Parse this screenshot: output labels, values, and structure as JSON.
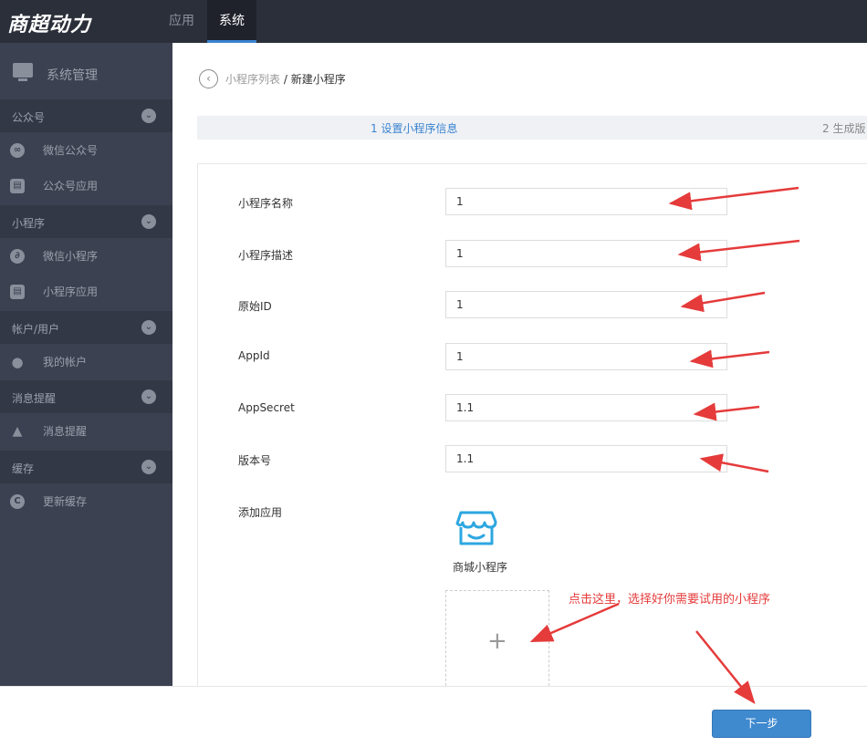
{
  "topbar": {
    "logo": "商超动力",
    "tabs": [
      {
        "label": "应用"
      },
      {
        "label": "系统"
      }
    ]
  },
  "sidebar": {
    "header": "系统管理",
    "groups": [
      {
        "label": "公众号",
        "items": [
          {
            "label": "微信公众号",
            "icon": "wechat-icon"
          },
          {
            "label": "公众号应用",
            "icon": "app-bag-icon"
          }
        ]
      },
      {
        "label": "小程序",
        "items": [
          {
            "label": "微信小程序",
            "icon": "mini-program-icon"
          },
          {
            "label": "小程序应用",
            "icon": "app-bag-icon"
          }
        ]
      },
      {
        "label": "帐户/用户",
        "items": [
          {
            "label": "我的帐户",
            "icon": "user-icon"
          }
        ]
      },
      {
        "label": "消息提醒",
        "items": [
          {
            "label": "消息提醒",
            "icon": "bell-icon"
          }
        ]
      },
      {
        "label": "缓存",
        "items": [
          {
            "label": "更新缓存",
            "icon": "refresh-icon"
          }
        ]
      }
    ]
  },
  "breadcrumb": {
    "parent": "小程序列表",
    "separator": "/",
    "current": "新建小程序"
  },
  "steps": {
    "step1": "1 设置小程序信息",
    "step2": "2 生成版"
  },
  "form": {
    "fields": [
      {
        "label": "小程序名称",
        "value": "1"
      },
      {
        "label": "小程序描述",
        "value": "1"
      },
      {
        "label": "原始ID",
        "value": "1"
      },
      {
        "label": "AppId",
        "value": "1"
      },
      {
        "label": "AppSecret",
        "value": "1.1"
      },
      {
        "label": "版本号",
        "value": "1.1"
      }
    ],
    "add_app_label": "添加应用",
    "app": {
      "name": "商城小程序",
      "icon": "store-icon"
    },
    "add_symbol": "+"
  },
  "annotation": {
    "hint": "点击这里，选择好你需要试用的小程序",
    "color": "#e53b3b"
  },
  "footer": {
    "next_label": "下一步"
  },
  "colors": {
    "accent": "#3a84d0",
    "sidebar_bg": "#3b4150",
    "topbar_bg": "#2b2f3a"
  }
}
